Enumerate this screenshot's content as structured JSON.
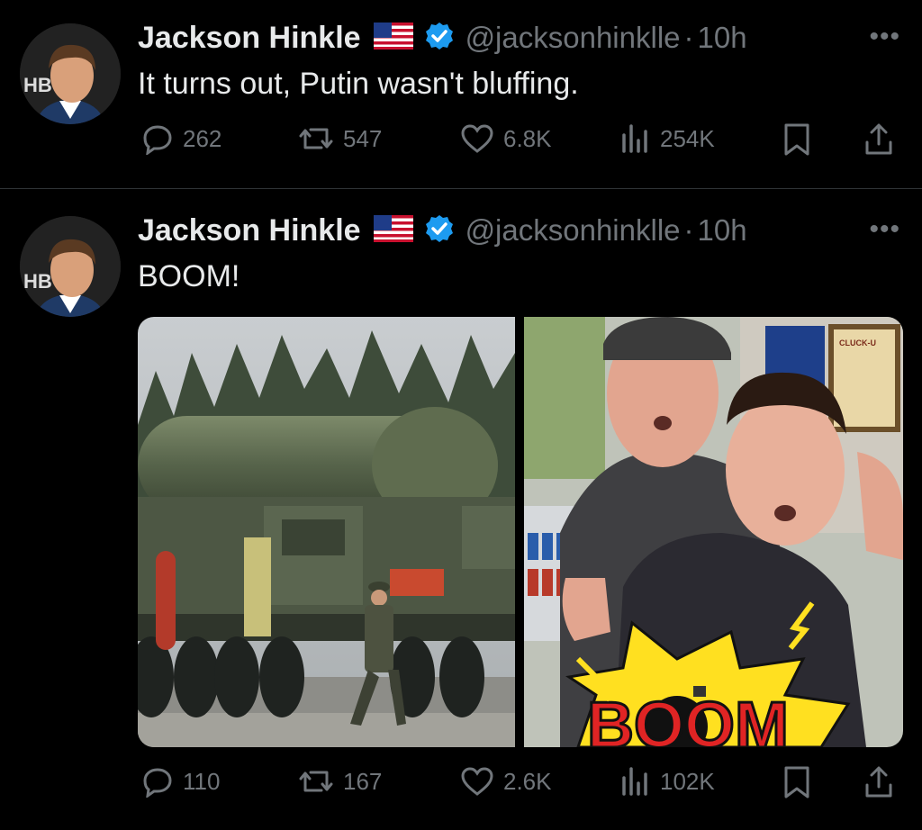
{
  "tweets": [
    {
      "author_name": "Jackson Hinkle",
      "handle": "@jacksonhinklle",
      "time": "10h",
      "text": "It turns out, Putin wasn't bluffing.",
      "replies": "262",
      "reposts": "547",
      "likes": "6.8K",
      "views": "254K"
    },
    {
      "author_name": "Jackson Hinkle",
      "handle": "@jacksonhinklle",
      "time": "10h",
      "text": "BOOM!",
      "replies": "110",
      "reposts": "167",
      "likes": "2.6K",
      "views": "102K",
      "media": {
        "left_alt": "missile-launcher-truck",
        "right_alt": "two-people-surprised",
        "right_overlay_text": "BOOM",
        "right_sign_text": "CLUCK-U"
      }
    }
  ],
  "avatar_badge_text": "HB",
  "more_glyph": "•••",
  "separator": "·",
  "colors": {
    "accent": "#1d9bf0",
    "muted": "#71767b",
    "text": "#e7e9ea",
    "divider": "#2f3336"
  }
}
